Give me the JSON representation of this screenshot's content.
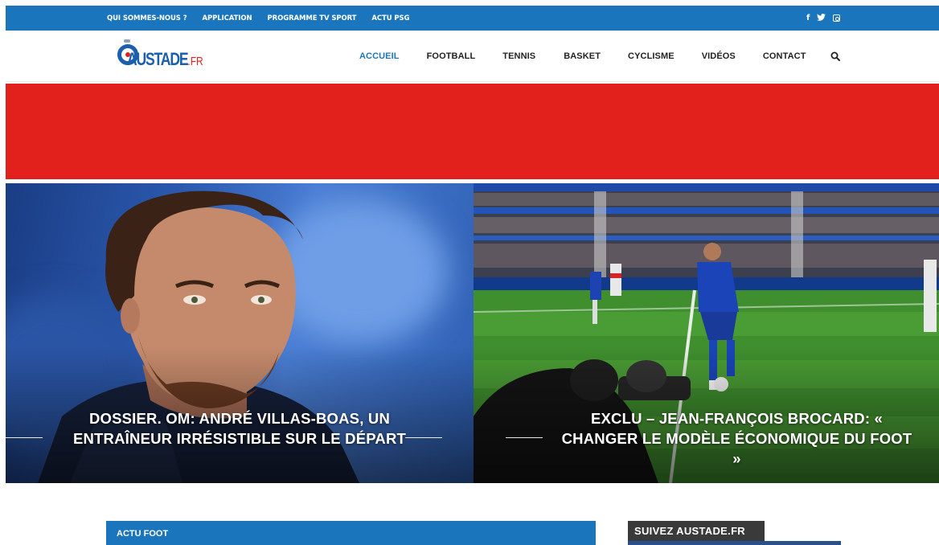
{
  "topbar": {
    "links": [
      "QUI SOMMES-NOUS ?",
      "APPLICATION",
      "PROGRAMME TV SPORT",
      "ACTU PSG"
    ],
    "social": {
      "facebook": "f",
      "twitter": "facebook-icon, twitter-icon, instagram-icon"
    },
    "color": "#1b75bc"
  },
  "header": {
    "logo_text": "AUSTADE",
    "logo_suffix": ".FR",
    "nav": [
      {
        "label": "ACCUEIL",
        "active": true
      },
      {
        "label": "FOOTBALL",
        "active": false
      },
      {
        "label": "TENNIS",
        "active": false
      },
      {
        "label": "BASKET",
        "active": false
      },
      {
        "label": "CYCLISME",
        "active": false
      },
      {
        "label": "VIDÉOS",
        "active": false
      },
      {
        "label": "CONTACT",
        "active": false
      }
    ],
    "search_icon": "search-icon"
  },
  "banner": {
    "color": "#e2211c"
  },
  "hero": [
    {
      "title": "DOSSIER. OM: ANDRÉ VILLAS-BOAS, UN ENTRAÎNEUR IRRÉSISTIBLE SUR LE DÉPART"
    },
    {
      "title": "EXCLU – JEAN-FRANÇOIS BROCARD: « CHANGER LE MODÈLE ÉCONOMIQUE DU FOOT »"
    }
  ],
  "sections": {
    "actu_foot": "ACTU FOOT",
    "follow": "SUIVEZ AUSTADE.FR"
  }
}
